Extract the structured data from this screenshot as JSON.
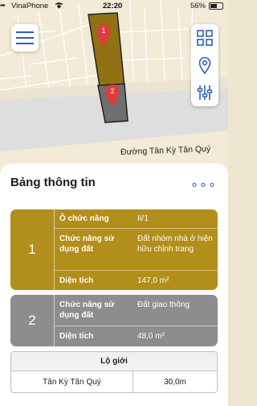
{
  "status_bar": {
    "carrier": "VinaPhone",
    "time": "22:20",
    "battery": "56%"
  },
  "map": {
    "street_label": "Đường Tân Kỳ Tân Quý",
    "markers": [
      "1",
      "2"
    ]
  },
  "sheet": {
    "title": "Bảng thông tin",
    "more_label": "∘∘∘"
  },
  "parcels": [
    {
      "index": "1",
      "color": "#b28e1a",
      "rows": [
        {
          "label": "Ô chức năng",
          "value": "II/1"
        },
        {
          "label": "Chức năng sử dụng đất",
          "value": "Đất nhóm nhà ở hiện hữu chỉnh trang"
        },
        {
          "label": "Diện tích",
          "value": "147,0 m²"
        }
      ]
    },
    {
      "index": "2",
      "color": "#8d8d8d",
      "rows": [
        {
          "label": "Chức năng sử dụng đất",
          "value": "Đất giao thông"
        },
        {
          "label": "Diện tích",
          "value": "48,0 m²"
        }
      ]
    }
  ],
  "lo_gioi": {
    "header": "Lộ giới",
    "road": "Tân Kỳ Tân Quý",
    "width": "30,0m"
  }
}
